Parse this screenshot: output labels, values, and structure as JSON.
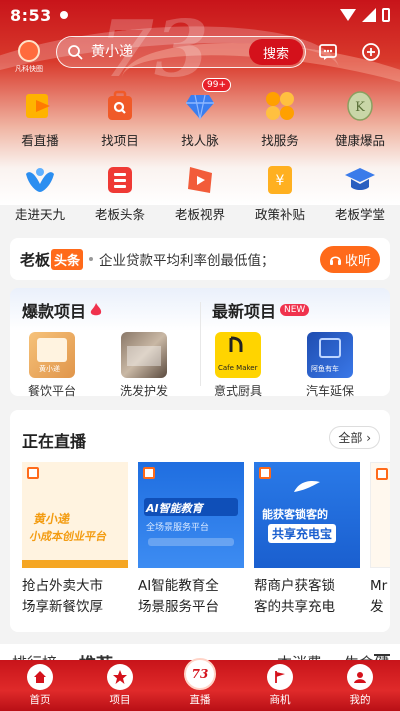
{
  "status_bar": {
    "time": "8:53"
  },
  "header": {
    "logo_text": "凡科快图",
    "search_placeholder": "黄小递",
    "search_button": "搜索"
  },
  "grid_row1": [
    {
      "label": "看直播",
      "icon": "play-icon",
      "color": "#ffb300"
    },
    {
      "label": "找项目",
      "icon": "search-bag-icon",
      "color": "#f05a28"
    },
    {
      "label": "找人脉",
      "icon": "diamond-icon",
      "color": "#3a7ef0",
      "badge": "99+"
    },
    {
      "label": "找服务",
      "icon": "flower-icon",
      "color": "#ffa000"
    },
    {
      "label": "健康爆品",
      "icon": "health-icon",
      "color": "#9db57a"
    }
  ],
  "grid_row2": [
    {
      "label": "走进天九",
      "icon": "bird-icon",
      "color": "#2b8ef0"
    },
    {
      "label": "老板头条",
      "icon": "headline-icon",
      "color": "#ef3a35"
    },
    {
      "label": "老板视界",
      "icon": "video-icon",
      "color": "#f25c3a"
    },
    {
      "label": "政策补贴",
      "icon": "subsidy-icon",
      "color": "#ffb020"
    },
    {
      "label": "老板学堂",
      "icon": "school-icon",
      "color": "#3b7bea"
    }
  ],
  "news": {
    "brand": "老板",
    "tag": "头条",
    "text": "企业贷款平均利率创最低值；",
    "button": "收听"
  },
  "projects": {
    "hot_title": "爆款项目",
    "new_title": "最新项目",
    "new_badge": "NEW",
    "hot_items": [
      {
        "label": "餐饮平台",
        "thumb_text": "黄小递"
      },
      {
        "label": "洗发护发",
        "thumb_text": ""
      }
    ],
    "new_items": [
      {
        "label": "意式厨具",
        "thumb_text": "Cafe Maker"
      },
      {
        "label": "汽车延保",
        "thumb_text": "阿鱼有车"
      }
    ]
  },
  "live": {
    "title": "正在直播",
    "all_button": "全部",
    "items": [
      {
        "text_line1": "抢占外卖大市",
        "text_line2": "场享新餐饮厚",
        "thumb_title": "黄小递",
        "thumb_sub": "小成本创业平台",
        "thumb_color": "#fff3e0"
      },
      {
        "text_line1": "AI智能教育全",
        "text_line2": "场景服务平台",
        "thumb_title": "AI智能教育",
        "thumb_sub": "全场景服务平台",
        "thumb_color": "#1f6ee0"
      },
      {
        "text_line1": "帮商户获客锁",
        "text_line2": "客的共享充电",
        "thumb_title": "能获客锁客的",
        "thumb_sub": "共享充电宝",
        "thumb_color": "#1f6fe0"
      },
      {
        "text_line1": "Mr",
        "text_line2": "发",
        "thumb_title": "",
        "thumb_sub": "",
        "thumb_color": "#ffffff"
      }
    ]
  },
  "sub_tabs": [
    "排行榜",
    "推荐",
    "",
    "",
    "本消费",
    "生命健"
  ],
  "bottom_nav": [
    {
      "label": "首页",
      "icon": "home-icon"
    },
    {
      "label": "项目",
      "icon": "star-icon"
    },
    {
      "label": "直播",
      "icon": "live-73-icon"
    },
    {
      "label": "商机",
      "icon": "flag-icon"
    },
    {
      "label": "我的",
      "icon": "profile-icon"
    }
  ]
}
